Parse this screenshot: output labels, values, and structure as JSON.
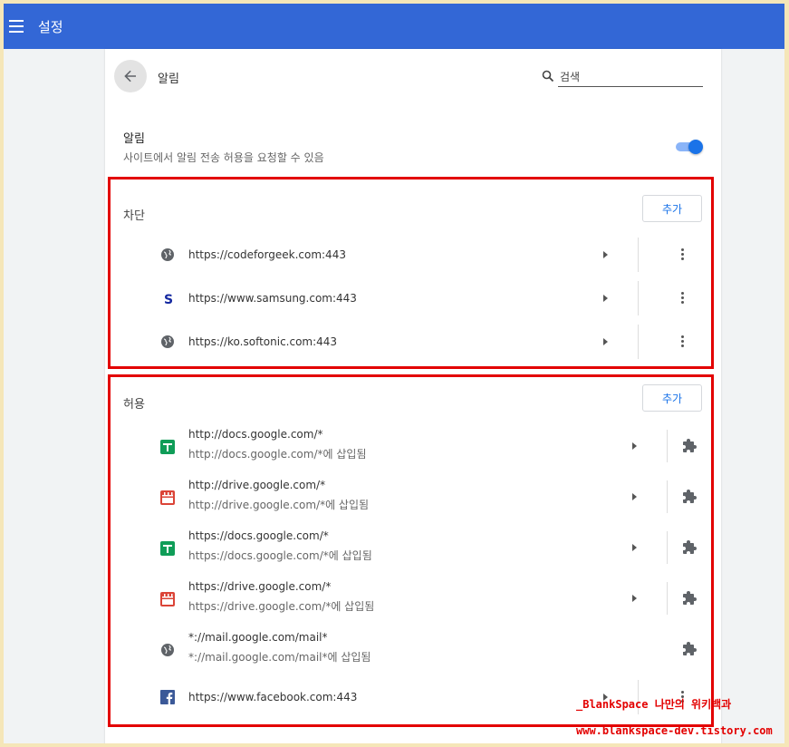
{
  "app": {
    "title": "설정"
  },
  "header": {
    "page_title": "알림",
    "search_placeholder": "검색"
  },
  "notifications": {
    "title": "알림",
    "subtitle": "사이트에서 알림 전송 허용을 요청할 수 있음",
    "enabled": true
  },
  "blocked": {
    "label": "차단",
    "add_label": "추가",
    "items": [
      {
        "url": "https://codeforgeek.com:443",
        "icon": "globe-icon"
      },
      {
        "url": "https://www.samsung.com:443",
        "icon": "samsung-icon"
      },
      {
        "url": "https://ko.softonic.com:443",
        "icon": "globe-icon"
      }
    ]
  },
  "allowed": {
    "label": "허용",
    "add_label": "추가",
    "items": [
      {
        "url": "http://docs.google.com/*",
        "sub": "http://docs.google.com/*에 삽입됨",
        "icon": "google-docs-icon"
      },
      {
        "url": "http://drive.google.com/*",
        "sub": "http://drive.google.com/*에 삽입됨",
        "icon": "google-drive-icon"
      },
      {
        "url": "https://docs.google.com/*",
        "sub": "https://docs.google.com/*에 삽입됨",
        "icon": "google-docs-icon"
      },
      {
        "url": "https://drive.google.com/*",
        "sub": "https://drive.google.com/*에 삽입됨",
        "icon": "google-drive-icon"
      },
      {
        "url": "*://mail.google.com/mail*",
        "sub": "*://mail.google.com/mail*에 삽입됨",
        "icon": "globe-icon"
      },
      {
        "url": "https://www.facebook.com:443",
        "icon": "facebook-icon"
      }
    ]
  },
  "watermark": {
    "line1": "_BlankSpace 나만의 위키백과",
    "line2": "www.blankspace-dev.tistory.com"
  },
  "colors": {
    "appbar": "#3367d6",
    "accent": "#1a73e8",
    "highlight": "#e30000"
  }
}
